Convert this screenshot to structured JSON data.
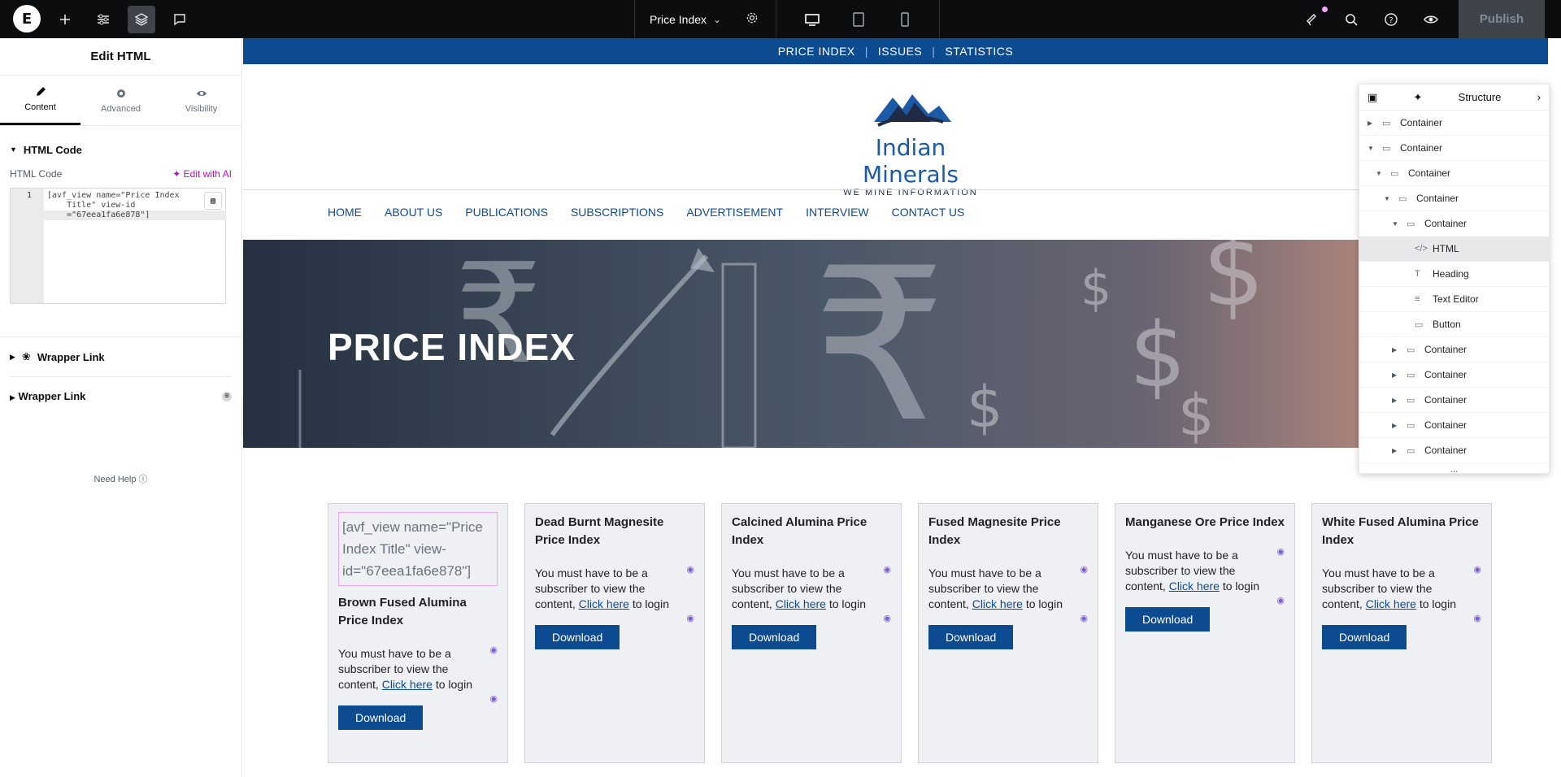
{
  "topbar": {
    "logo_letter": "E",
    "page_name": "Price Index",
    "publish_label": "Publish",
    "icons": [
      "add-icon",
      "settings-sliders-icon",
      "layers-icon",
      "comments-icon",
      "gear-icon",
      "desktop-icon",
      "tablet-icon",
      "mobile-icon",
      "notifications-icon",
      "search-icon",
      "help-icon",
      "preview-icon"
    ]
  },
  "panel": {
    "title": "Edit HTML",
    "tabs": [
      {
        "label": "Content"
      },
      {
        "label": "Advanced"
      },
      {
        "label": "Visibility"
      }
    ],
    "section_title": "HTML Code",
    "field_label": "HTML Code",
    "ai_label": "Edit with AI",
    "code_line_number": "1",
    "code_text": "[avf_view name=\"Price Index\n    Title\" view-id\n    =\"67eea1fa6e878\"]",
    "wrapper_link_1": "Wrapper Link",
    "wrapper_link_2": "Wrapper Link",
    "need_help": "Need Help"
  },
  "site": {
    "top_links": [
      "PRICE INDEX",
      "ISSUES",
      "STATISTICS"
    ],
    "brand_name": "Indian Minerals",
    "brand_tagline": "WE MINE INFORMATION",
    "nav": [
      "HOME",
      "ABOUT US",
      "PUBLICATIONS",
      "SUBSCRIPTIONS",
      "ADVERTISEMENT",
      "INTERVIEW",
      "CONTACT US"
    ],
    "hero_title": "PRICE INDEX",
    "placeholder_text": "[avf_view name=\"Price Index Title\" view-id=\"67eea1fa6e878\"]",
    "body_pre": "You must have to be a subscriber to view the content, ",
    "body_link": "Click here",
    "body_post": " to login",
    "download_label": "Download",
    "cards": [
      {
        "title": "Brown Fused Alumina Price Index"
      },
      {
        "title": "Dead Burnt Magnesite Price Index"
      },
      {
        "title": "Calcined Alumina Price Index"
      },
      {
        "title": "Fused Magnesite Price Index"
      },
      {
        "title": "Manganese Ore Price Index"
      },
      {
        "title": "White Fused Alumina Price Index"
      }
    ]
  },
  "structure": {
    "title": "Structure",
    "items": [
      {
        "label": "Container"
      },
      {
        "label": "Container"
      },
      {
        "label": "Container"
      },
      {
        "label": "Container"
      },
      {
        "label": "Container"
      },
      {
        "label": "HTML"
      },
      {
        "label": "Heading"
      },
      {
        "label": "Text Editor"
      },
      {
        "label": "Button"
      },
      {
        "label": "Container"
      },
      {
        "label": "Container"
      },
      {
        "label": "Container"
      },
      {
        "label": "Container"
      },
      {
        "label": "Container"
      }
    ],
    "more": "..."
  }
}
